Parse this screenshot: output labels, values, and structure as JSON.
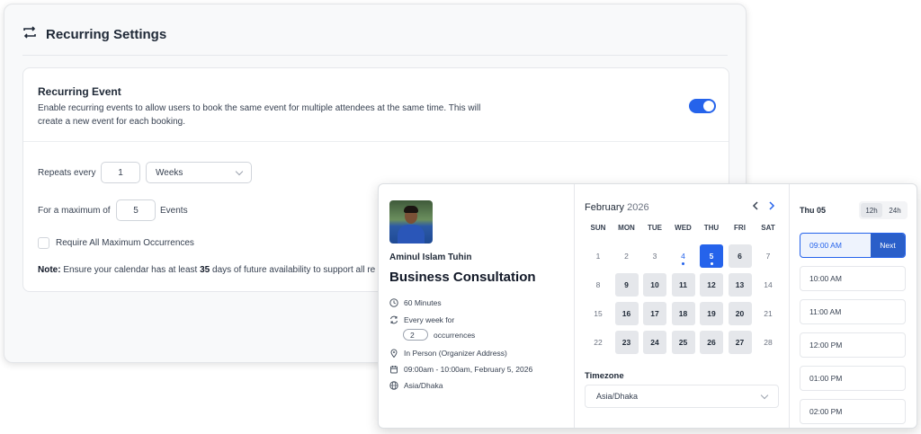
{
  "settings": {
    "title": "Recurring Settings",
    "recurring_event": {
      "heading": "Recurring Event",
      "description": "Enable recurring events to allow users to book the same event for multiple attendees at the same time. This will create a new event for each booking.",
      "toggle_on": true
    },
    "repeats_label": "Repeats every",
    "repeats_value": "1",
    "repeats_unit": "Weeks",
    "max_label": "For a maximum of",
    "max_value": "5",
    "max_unit": "Events",
    "require_max_label": "Require All Maximum Occurrences",
    "note_prefix": "Note:",
    "note_text": "Ensure your calendar has at least",
    "note_days": "35",
    "note_suffix": "days of future availability to support all re"
  },
  "booking": {
    "host_name": "Aminul Islam Tuhin",
    "event_title": "Business Consultation",
    "duration": "60 Minutes",
    "recurrence": "Every week for",
    "occurrences_value": "2",
    "occurrences_label": "occurrences",
    "location": "In Person (Organizer Address)",
    "time_range": "09:00am - 10:00am, February 5, 2026",
    "timezone_short": "Asia/Dhaka",
    "calendar": {
      "month": "February",
      "year": "2026",
      "weekdays": [
        "SUN",
        "MON",
        "TUE",
        "WED",
        "THU",
        "FRI",
        "SAT"
      ],
      "weeks": [
        [
          {
            "d": "1",
            "s": "off"
          },
          {
            "d": "2",
            "s": "off"
          },
          {
            "d": "3",
            "s": "off"
          },
          {
            "d": "4",
            "s": "today"
          },
          {
            "d": "5",
            "s": "sel"
          },
          {
            "d": "6",
            "s": "avail"
          },
          {
            "d": "7",
            "s": "off"
          }
        ],
        [
          {
            "d": "8",
            "s": "off"
          },
          {
            "d": "9",
            "s": "avail"
          },
          {
            "d": "10",
            "s": "avail"
          },
          {
            "d": "11",
            "s": "avail"
          },
          {
            "d": "12",
            "s": "avail"
          },
          {
            "d": "13",
            "s": "avail"
          },
          {
            "d": "14",
            "s": "off"
          }
        ],
        [
          {
            "d": "15",
            "s": "off"
          },
          {
            "d": "16",
            "s": "avail"
          },
          {
            "d": "17",
            "s": "avail"
          },
          {
            "d": "18",
            "s": "avail"
          },
          {
            "d": "19",
            "s": "avail"
          },
          {
            "d": "20",
            "s": "avail"
          },
          {
            "d": "21",
            "s": "off"
          }
        ],
        [
          {
            "d": "22",
            "s": "off"
          },
          {
            "d": "23",
            "s": "avail"
          },
          {
            "d": "24",
            "s": "avail"
          },
          {
            "d": "25",
            "s": "avail"
          },
          {
            "d": "26",
            "s": "avail"
          },
          {
            "d": "27",
            "s": "avail"
          },
          {
            "d": "28",
            "s": "off"
          }
        ]
      ]
    },
    "timezone_label": "Timezone",
    "timezone_value": "Asia/Dhaka",
    "selected_date": "Thu 05",
    "format_12h": "12h",
    "format_24h": "24h",
    "next_label": "Next",
    "slots": [
      "09:00 AM",
      "10:00 AM",
      "11:00 AM",
      "12:00 PM",
      "01:00 PM",
      "02:00 PM"
    ]
  },
  "colors": {
    "accent": "#2563eb",
    "available_day": "#e5e7eb"
  }
}
